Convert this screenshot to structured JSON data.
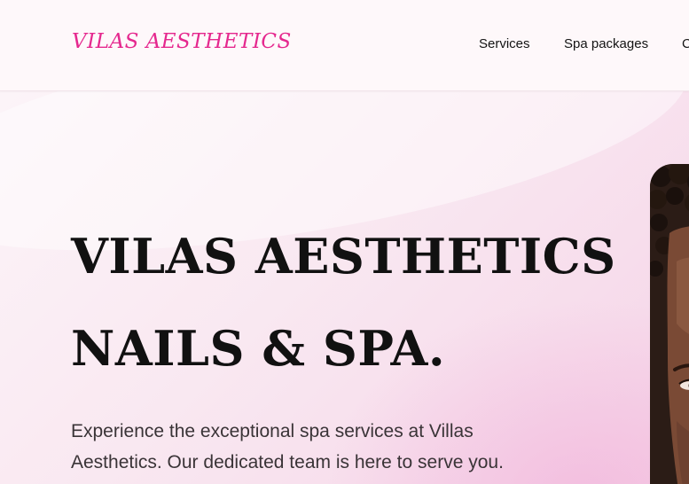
{
  "brand": {
    "name": "VILAS AESTHETICS"
  },
  "nav": {
    "items": [
      {
        "label": "Services"
      },
      {
        "label": "Spa packages"
      },
      {
        "label": "C"
      }
    ]
  },
  "hero": {
    "heading_line_1": "VILAS AESTHETICS",
    "heading_line_2": "NAILS & SPA.",
    "description": "Experience the exceptional spa services at Villas Aesthetics. Our dedicated team is here to serve you."
  },
  "colors": {
    "brand_accent": "#e5288e",
    "heading_text": "#111111",
    "body_text": "#3a3437",
    "hero_background": "#f9e8f1"
  }
}
